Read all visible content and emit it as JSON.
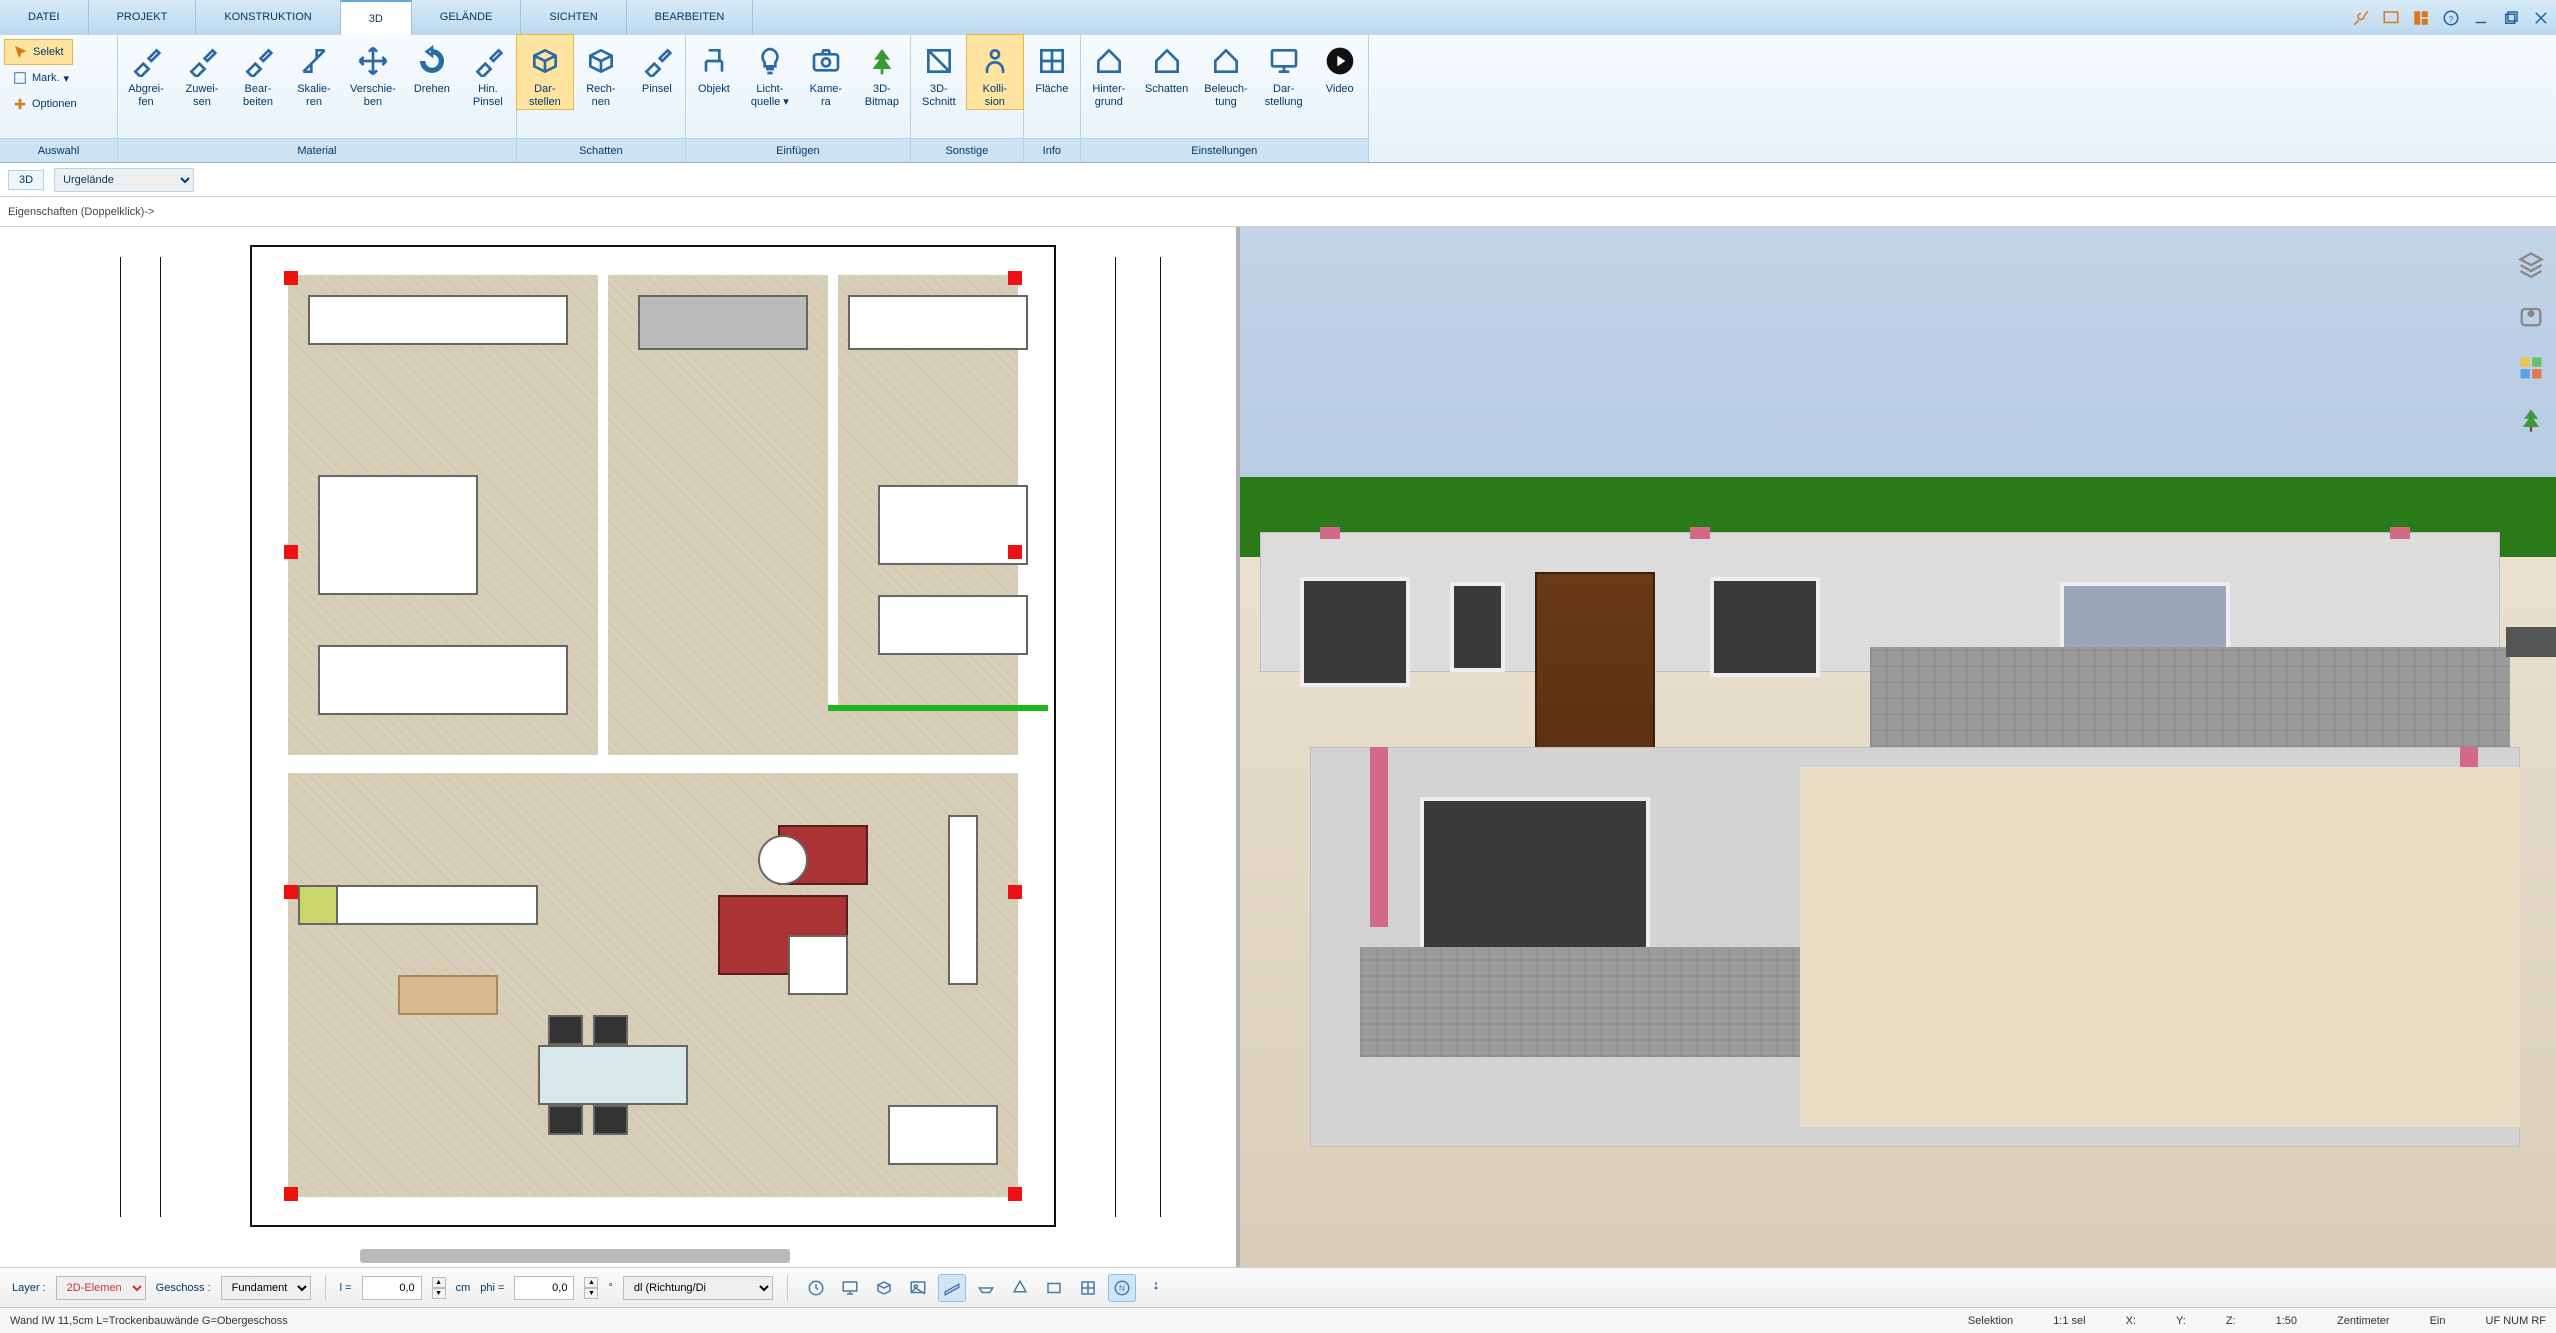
{
  "menu": {
    "tabs": [
      "DATEI",
      "PROJEKT",
      "KONSTRUKTION",
      "3D",
      "GELÄNDE",
      "SICHTEN",
      "BEARBEITEN"
    ],
    "active_index": 3
  },
  "window_icons": [
    "tools-icon",
    "layers-window-icon",
    "layout-icon",
    "help-icon",
    "minimize-icon",
    "restore-icon",
    "close-icon"
  ],
  "ribbon": {
    "auswahl": {
      "title": "Auswahl",
      "selekt": "Selekt",
      "mark": "Mark.",
      "optionen": "Optionen"
    },
    "material": {
      "title": "Material",
      "items": [
        {
          "l1": "Abgrei-",
          "l2": "fen"
        },
        {
          "l1": "Zuwei-",
          "l2": "sen"
        },
        {
          "l1": "Bear-",
          "l2": "beiten"
        },
        {
          "l1": "Skalie-",
          "l2": "ren"
        },
        {
          "l1": "Verschie-",
          "l2": "ben"
        },
        {
          "l1": "Drehen",
          "l2": ""
        },
        {
          "l1": "Hin.",
          "l2": "Pinsel"
        }
      ]
    },
    "schatten": {
      "title": "Schatten",
      "items": [
        {
          "l1": "Dar-",
          "l2": "stellen",
          "sel": true
        },
        {
          "l1": "Rech-",
          "l2": "nen"
        },
        {
          "l1": "Pinsel",
          "l2": ""
        }
      ]
    },
    "einfuegen": {
      "title": "Einfügen",
      "items": [
        {
          "l1": "Objekt",
          "l2": ""
        },
        {
          "l1": "Licht-",
          "l2": "quelle",
          "dd": true
        },
        {
          "l1": "Kame-",
          "l2": "ra"
        },
        {
          "l1": "3D-",
          "l2": "Bitmap"
        }
      ]
    },
    "sonstige": {
      "title": "Sonstige",
      "items": [
        {
          "l1": "3D-",
          "l2": "Schnitt"
        },
        {
          "l1": "Kolli-",
          "l2": "sion",
          "sel": true
        }
      ]
    },
    "info": {
      "title": "Info",
      "items": [
        {
          "l1": "Fläche",
          "l2": ""
        }
      ]
    },
    "einstellungen": {
      "title": "Einstellungen",
      "items": [
        {
          "l1": "Hinter-",
          "l2": "grund"
        },
        {
          "l1": "Schatten",
          "l2": ""
        },
        {
          "l1": "Beleuch-",
          "l2": "tung"
        },
        {
          "l1": "Dar-",
          "l2": "stellung"
        },
        {
          "l1": "Video",
          "l2": ""
        }
      ]
    }
  },
  "viewbar": {
    "mode": "3D",
    "dropdown": "Urgelände"
  },
  "propbar": {
    "text": "Eigenschaften (Doppelklick)->"
  },
  "bottom": {
    "layer_lbl": "Layer :",
    "layer_val": "2D-Elemen",
    "geschoss_lbl": "Geschoss :",
    "geschoss_val": "Fundament",
    "l_lbl": "l =",
    "l_val": "0,0",
    "cm": "cm",
    "phi_lbl": "phi =",
    "phi_val": "0,0",
    "deg": "°",
    "dl_val": "dl (Richtung/Di",
    "tool_icons": [
      "clock-icon",
      "monitor-icon",
      "cubes-icon",
      "picture-icon",
      "plane1-icon",
      "plane2-icon",
      "plane3-icon",
      "plane4-icon",
      "grid-icon",
      "north-icon",
      "info-icon"
    ],
    "tool_sel": [
      false,
      false,
      false,
      false,
      true,
      false,
      false,
      false,
      false,
      true,
      false
    ]
  },
  "status": {
    "left": "Wand IW 11,5cm L=Trockenbauwände G=Obergeschoss",
    "selektion": "Selektion",
    "sel": "1:1 sel",
    "x": "X:",
    "y": "Y:",
    "z": "Z:",
    "scale": "1:50",
    "unit": "Zentimeter",
    "ein": "Ein",
    "flags": "UF NUM RF"
  },
  "right_toolbar": [
    "layers-icon",
    "texture-icon",
    "palette-icon",
    "tree-icon"
  ]
}
